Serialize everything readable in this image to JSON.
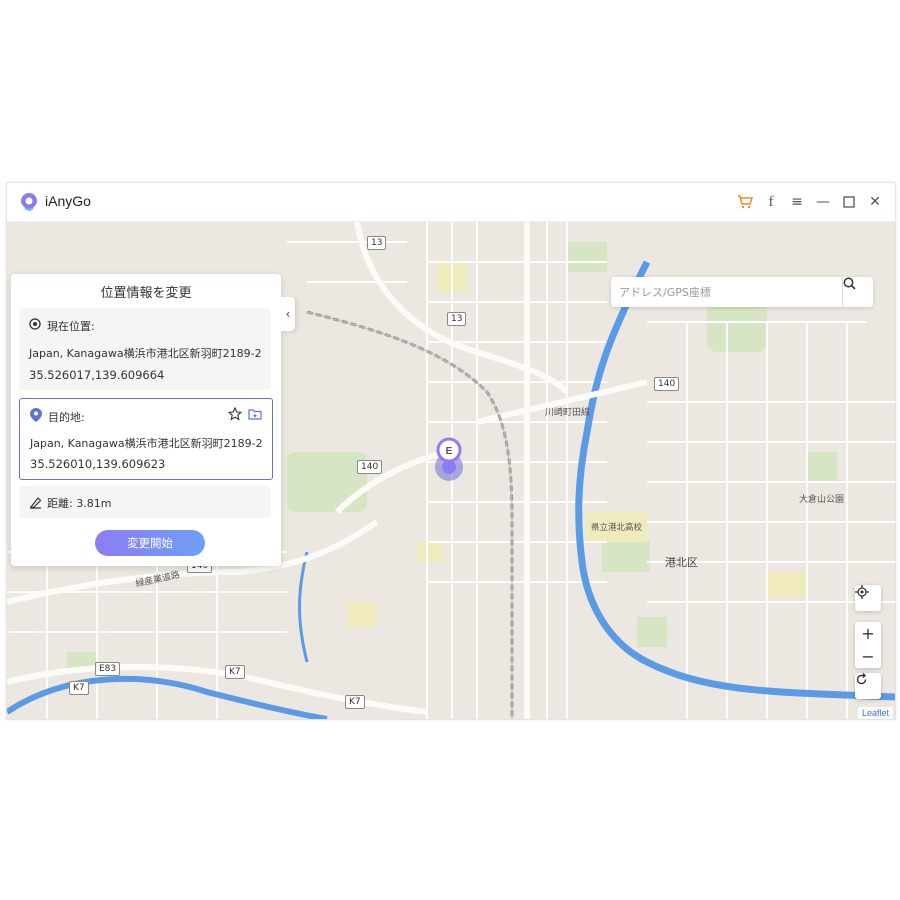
{
  "app": {
    "title": "iAnyGo"
  },
  "panel": {
    "title": "位置情報を変更",
    "current": {
      "label": "現在位置:",
      "address": "Japan, Kanagawa横浜市港北区新羽町2189-2",
      "coords": "35.526017,139.609664"
    },
    "destination": {
      "label": "目的地:",
      "address": "Japan, Kanagawa横浜市港北区新羽町2189-2",
      "coords": "35.526010,139.609623"
    },
    "distance": "距離: 3.81m",
    "start_button": "変更開始"
  },
  "search": {
    "placeholder": "アドレス/GPS座標"
  },
  "map": {
    "marker_label": "E",
    "district_label": "港北区",
    "school_label": "県立港北高校",
    "park_label": "大倉山公園",
    "road_labels": {
      "kawawa": "川崎町田線",
      "ryokusan": "緑産業道路",
      "kohoku_road": "港北区"
    },
    "route_shields": [
      "13",
      "13",
      "140",
      "140",
      "140",
      "140",
      "E83",
      "K7",
      "K7",
      "K7"
    ],
    "attribution": "Leaflet"
  },
  "controls": {
    "zoom_in": "+",
    "zoom_out": "−"
  },
  "colors": {
    "accent": "#6e6fd1",
    "river": "#5b9be6",
    "button_start": "#8d7cf5",
    "button_end": "#6e9ff7"
  }
}
